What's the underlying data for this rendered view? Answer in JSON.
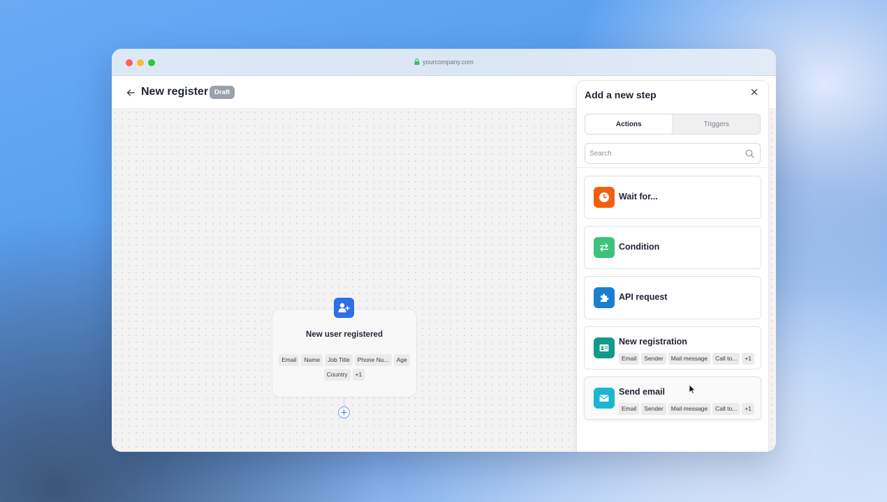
{
  "browser": {
    "url": "yourcompany.com"
  },
  "header": {
    "title": "New register",
    "badge": "Draft"
  },
  "node": {
    "title": "New user registered",
    "fields": [
      "Email",
      "Name",
      "Job Title",
      "Phone Nu...",
      "Age",
      "Country",
      "+1"
    ]
  },
  "panel": {
    "title": "Add a new step",
    "tabs": [
      {
        "label": "Actions",
        "active": true
      },
      {
        "label": "Triggers",
        "active": false
      }
    ],
    "search": {
      "placeholder": "Search",
      "value": ""
    },
    "items": [
      {
        "label": "Wait for...",
        "icon": "clock-icon",
        "color": "#f0600f",
        "tags": []
      },
      {
        "label": "Condition",
        "icon": "swap-arrows-icon",
        "color": "#3cc27a",
        "tags": []
      },
      {
        "label": "API request",
        "icon": "puzzle-icon",
        "color": "#1a7fd0",
        "tags": []
      },
      {
        "label": "New registration",
        "icon": "id-card-icon",
        "color": "#12998a",
        "tags": [
          "Email",
          "Sender",
          "Mail message",
          "Call to...",
          "+1"
        ]
      },
      {
        "label": "Send email",
        "icon": "mail-icon",
        "color": "#1bb6d1",
        "tags": [
          "Email",
          "Sender",
          "Mail message",
          "Call to...",
          "+1"
        ]
      }
    ]
  },
  "colors": {
    "node_icon": "#2f6fe6",
    "badge": "#9aa1ad",
    "add_step_ring": "#6ea0ec"
  }
}
